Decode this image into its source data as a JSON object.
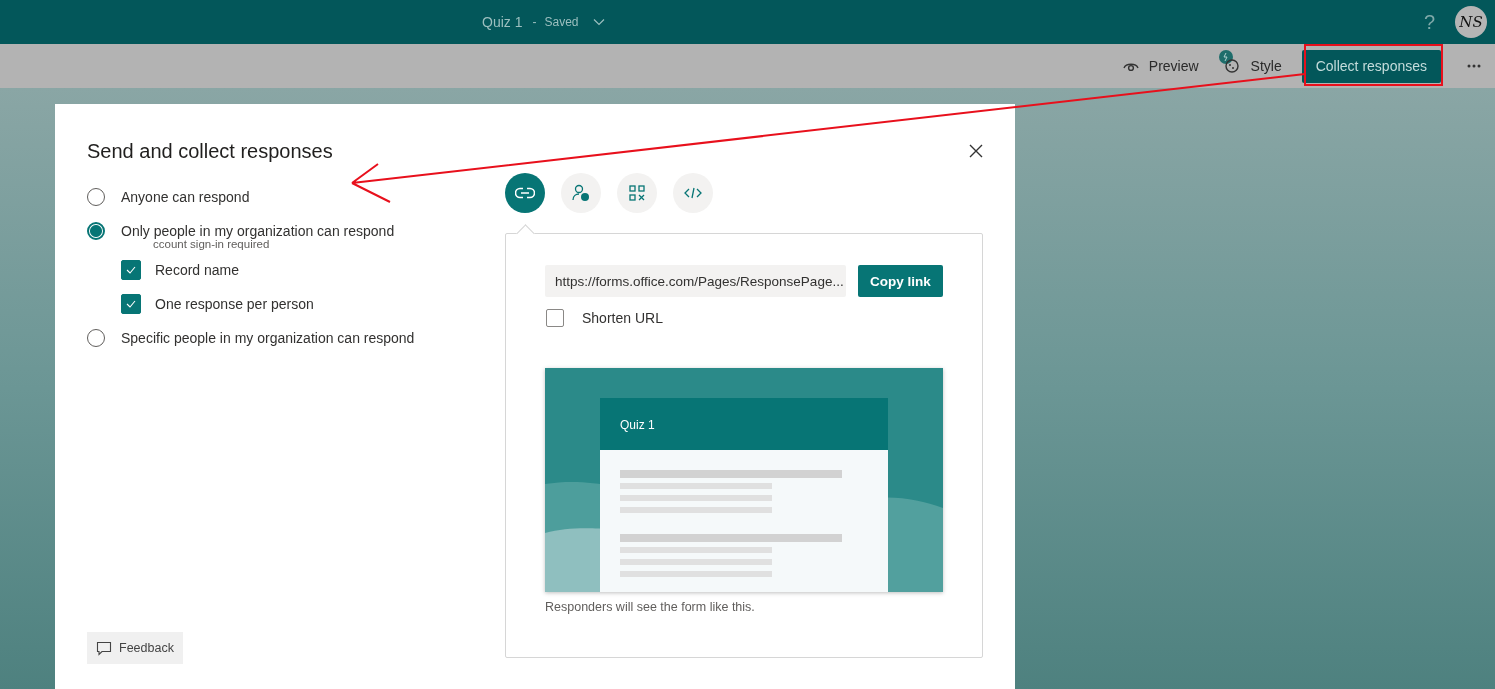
{
  "topbar": {
    "title": "Quiz 1",
    "separator": "-",
    "status": "Saved",
    "help": "?",
    "avatar": "NS"
  },
  "toolbar": {
    "preview": "Preview",
    "style": "Style",
    "collect": "Collect responses"
  },
  "dialog": {
    "title": "Send and collect responses",
    "options": [
      {
        "label": "Anyone can respond",
        "selected": false
      },
      {
        "label": "Only people in my organization can respond",
        "selected": true,
        "note": "ccount sign-in required",
        "children": [
          {
            "label": "Record name",
            "checked": true
          },
          {
            "label": "One response per person",
            "checked": true
          }
        ]
      },
      {
        "label": "Specific people in my organization can respond",
        "selected": false
      }
    ],
    "share_tabs": [
      {
        "kind": "link",
        "selected": true
      },
      {
        "kind": "invite",
        "selected": false
      },
      {
        "kind": "qr",
        "selected": false
      },
      {
        "kind": "embed",
        "selected": false
      }
    ],
    "url": "https://forms.office.com/Pages/ResponsePage...",
    "copy_button": "Copy link",
    "shorten": {
      "label": "Shorten URL",
      "checked": false
    },
    "preview": {
      "form_title": "Quiz 1",
      "caption": "Responders will see the form like this."
    },
    "feedback": "Feedback"
  }
}
